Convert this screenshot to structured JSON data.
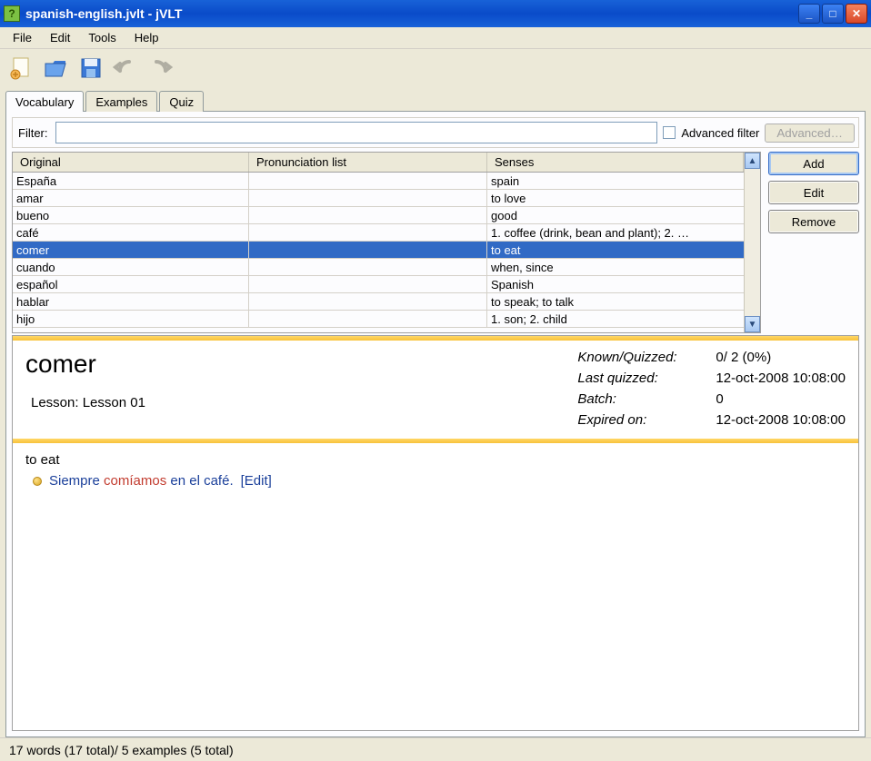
{
  "window": {
    "title": "spanish-english.jvlt - jVLT"
  },
  "menubar": {
    "items": [
      "File",
      "Edit",
      "Tools",
      "Help"
    ]
  },
  "tabs": {
    "items": [
      "Vocabulary",
      "Examples",
      "Quiz"
    ],
    "active": 0
  },
  "filter": {
    "label": "Filter:",
    "value": "",
    "adv_checkbox_label": "Advanced filter",
    "adv_button": "Advanced…"
  },
  "table": {
    "headers": [
      "Original",
      "Pronunciation list",
      "Senses"
    ],
    "rows": [
      {
        "original": "España",
        "pron": "",
        "senses": "spain",
        "selected": false
      },
      {
        "original": "amar",
        "pron": "",
        "senses": "to love",
        "selected": false
      },
      {
        "original": "bueno",
        "pron": "",
        "senses": "good",
        "selected": false
      },
      {
        "original": "café",
        "pron": "",
        "senses": "1. coffee (drink, bean and plant); 2. …",
        "selected": false
      },
      {
        "original": "comer",
        "pron": "",
        "senses": "to eat",
        "selected": true
      },
      {
        "original": "cuando",
        "pron": "",
        "senses": "when, since",
        "selected": false
      },
      {
        "original": "español",
        "pron": "",
        "senses": "Spanish",
        "selected": false
      },
      {
        "original": "hablar",
        "pron": "",
        "senses": "to speak; to talk",
        "selected": false
      },
      {
        "original": "hijo",
        "pron": "",
        "senses": "1. son; 2. child",
        "selected": false
      }
    ]
  },
  "side_buttons": {
    "add": "Add",
    "edit": "Edit",
    "remove": "Remove"
  },
  "detail": {
    "word": "comer",
    "lesson_label": "Lesson:",
    "lesson_value": "Lesson 01",
    "stats": {
      "known_label": "Known/Quizzed:",
      "known_value": "0/ 2 (0%)",
      "last_label": "Last quizzed:",
      "last_value": "12-oct-2008 10:08:00",
      "batch_label": "Batch:",
      "batch_value": "0",
      "expired_label": "Expired on:",
      "expired_value": "12-oct-2008 10:08:00"
    },
    "sense": "to eat",
    "example_pre": "Siempre ",
    "example_hl": "comíamos",
    "example_mid": " en el ",
    "example_link": "café",
    "example_post": ".",
    "edit_link": "[Edit]"
  },
  "statusbar": {
    "text": "17 words (17 total)/ 5 examples (5 total)"
  }
}
